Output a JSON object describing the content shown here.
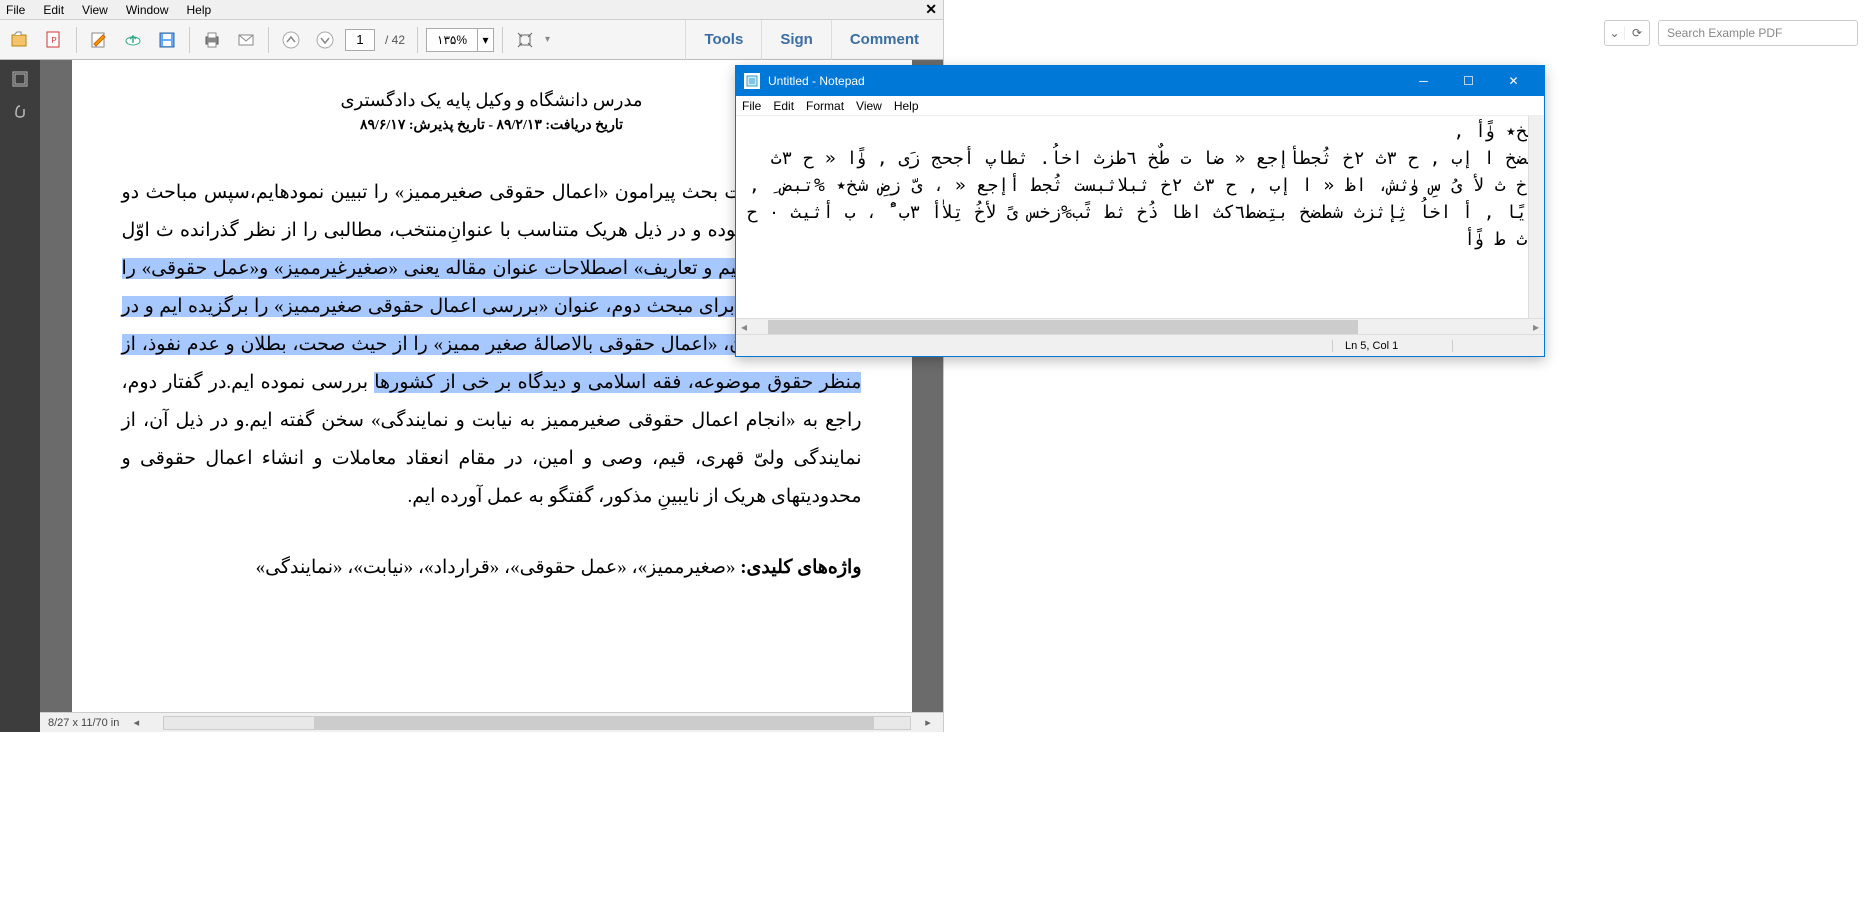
{
  "pdf": {
    "menu": {
      "file": "File",
      "edit": "Edit",
      "view": "View",
      "window": "Window",
      "help": "Help"
    },
    "toolbar": {
      "page_current": "1",
      "page_total": "/ 42",
      "zoom": "۱۳۵%",
      "tools": "Tools",
      "sign": "Sign",
      "comment": "Comment"
    },
    "statusbar": {
      "dims": "8/27 x 11/70 in"
    },
    "document": {
      "subtitle": "مدرس دانشگاه و وکیل پایه یک دادگستری",
      "date": "تاریخ دریافت: ۸۹/۲/۱۳ - تاریخ پذیرش: ۸۹/۶/۱۷",
      "body_pre": "ن مقاله، ضرورت بحث پیرامون «اعمال حقوقی صغیرممیز» را تبیین نمودهایم،سپس مباحث دو مبحث تقسیم نموده و در ذیل هریک متناسب با عنوانِ‌منتخب، مطالبی را از نظر گذرانده ث اوّل ذیل عنوان",
      "body_hl1": "«مفاهیم و تعاریف» اصطلاحات عنوان مقاله یعنی «صغیرغیرممیز» و«عمل حقوقی» را تعریف کرده ایم.برای مبحث دوم، عنوان «بررسی اعمال حقوقی صغیرممیز» را برگزیده ایم و در ذیل گفتار اوّل آن، «اعمال حقوقی بالاصالهٔ صغیر ممیز» را از حیث صحت، بطلان و عدم نفوذ،   از منظر حقوق موضوعه، فقه اسلامی و دیدگاه بر خی از کشورها",
      "body_post": " بررسی نموده ایم.در گفتار دوم، راجع به «انجام اعمال حقوقی صغیرممیز به نیابت و نمایندگی» سخن گفته ایم.و در ذیل آن، از نمایندگی ولیّ قهری، قیم، وصی و امین، در مقام انعقاد معاملات و انشاء اعمال حقوقی و محدودیتهای هریک از نایبینِ مذکور، گفتگو به عمل آورده ایم.",
      "keywords_label": "واژه‌های کلیدی:",
      "keywords_value": " «صغیرممیز»، «عمل حقوقی»، «قرارداد»، «نیابت»، «نمایندگی»"
    }
  },
  "browser": {
    "search_placeholder": "Search Example PDF"
  },
  "notepad": {
    "title": "Untitled - Notepad",
    "menu": {
      "file": "File",
      "edit": "Edit",
      "format": "Format",
      "view": "View",
      "help": "Help"
    },
    "content": "شخ٭ ۈًأ ,\nطضخ ا إب , ح ٣ث ٢خ ثُجطأإجع « ضا ت طٌخ ٦طزث اخاُ. ثطاپ أجحج زَی , ۈًا « ح ٣ث ٢خ ث لأ یُ سِ ۈثش، اظ « ا إب , ح ٣ث ٢خ ثبلاثبست ثُجط أإجع « ، یّ زضِ شخ٭ %تبض ِ , أیًا , أ اخاُ ثِإثزث شطضخ بتِضط٦کث اظا ذُخ ثط ثًب%زخس یً لأخُ تِلاٰأ ٣ب ًْ ، ب أثیث ۰ ح ٣ث ط ۈًأ\n",
    "status": {
      "pos": "Ln 5, Col 1"
    }
  }
}
